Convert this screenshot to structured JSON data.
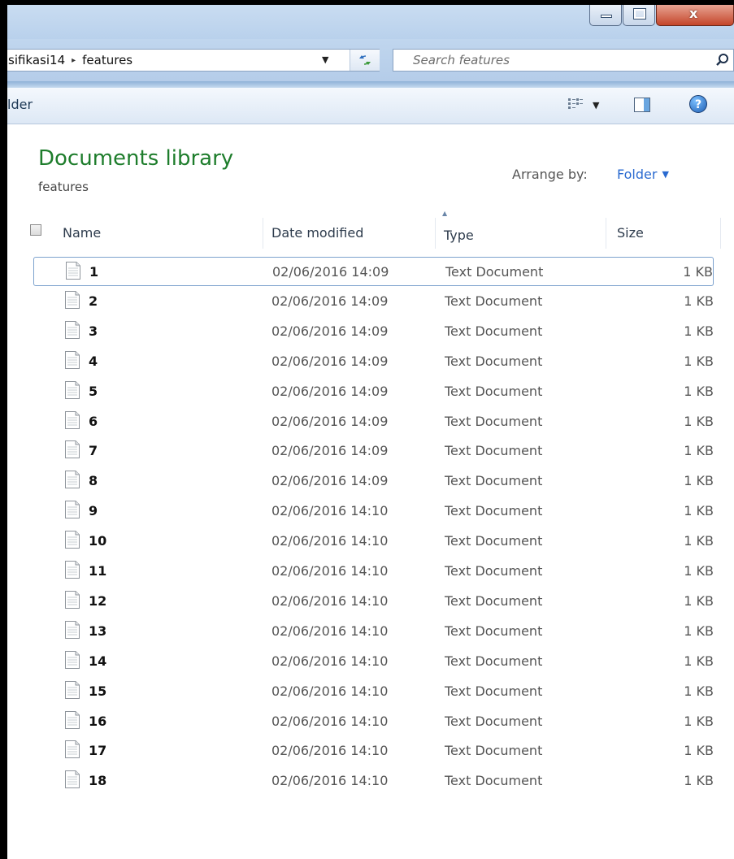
{
  "window": {
    "close_glyph": "x"
  },
  "address": {
    "crumbs": [
      "sifikasi14",
      "features"
    ],
    "separator": "▸"
  },
  "search": {
    "placeholder": "Search features"
  },
  "toolbar": {
    "partial_label": "lder"
  },
  "library": {
    "title": "Documents library",
    "subtitle": "features",
    "arrange_label": "Arrange by:",
    "arrange_value": "Folder"
  },
  "columns": {
    "name": "Name",
    "date": "Date modified",
    "type": "Type",
    "size": "Size",
    "sorted_by": "type"
  },
  "files": [
    {
      "name": "1",
      "date": "02/06/2016 14:09",
      "type": "Text Document",
      "size": "1 KB"
    },
    {
      "name": "2",
      "date": "02/06/2016 14:09",
      "type": "Text Document",
      "size": "1 KB"
    },
    {
      "name": "3",
      "date": "02/06/2016 14:09",
      "type": "Text Document",
      "size": "1 KB"
    },
    {
      "name": "4",
      "date": "02/06/2016 14:09",
      "type": "Text Document",
      "size": "1 KB"
    },
    {
      "name": "5",
      "date": "02/06/2016 14:09",
      "type": "Text Document",
      "size": "1 KB"
    },
    {
      "name": "6",
      "date": "02/06/2016 14:09",
      "type": "Text Document",
      "size": "1 KB"
    },
    {
      "name": "7",
      "date": "02/06/2016 14:09",
      "type": "Text Document",
      "size": "1 KB"
    },
    {
      "name": "8",
      "date": "02/06/2016 14:09",
      "type": "Text Document",
      "size": "1 KB"
    },
    {
      "name": "9",
      "date": "02/06/2016 14:10",
      "type": "Text Document",
      "size": "1 KB"
    },
    {
      "name": "10",
      "date": "02/06/2016 14:10",
      "type": "Text Document",
      "size": "1 KB"
    },
    {
      "name": "11",
      "date": "02/06/2016 14:10",
      "type": "Text Document",
      "size": "1 KB"
    },
    {
      "name": "12",
      "date": "02/06/2016 14:10",
      "type": "Text Document",
      "size": "1 KB"
    },
    {
      "name": "13",
      "date": "02/06/2016 14:10",
      "type": "Text Document",
      "size": "1 KB"
    },
    {
      "name": "14",
      "date": "02/06/2016 14:10",
      "type": "Text Document",
      "size": "1 KB"
    },
    {
      "name": "15",
      "date": "02/06/2016 14:10",
      "type": "Text Document",
      "size": "1 KB"
    },
    {
      "name": "16",
      "date": "02/06/2016 14:10",
      "type": "Text Document",
      "size": "1 KB"
    },
    {
      "name": "17",
      "date": "02/06/2016 14:10",
      "type": "Text Document",
      "size": "1 KB"
    },
    {
      "name": "18",
      "date": "02/06/2016 14:10",
      "type": "Text Document",
      "size": "1 KB"
    }
  ],
  "focused_row_index": 0,
  "icons": {
    "file": "text-document-icon",
    "search": "search-icon",
    "refresh": "refresh-icon",
    "views": "views-icon",
    "pane": "preview-pane-icon",
    "help": "help-icon"
  },
  "colors": {
    "library_title": "#1e7d2c",
    "arrange_value": "#2a6ad0",
    "close_button": "#c4452a"
  }
}
